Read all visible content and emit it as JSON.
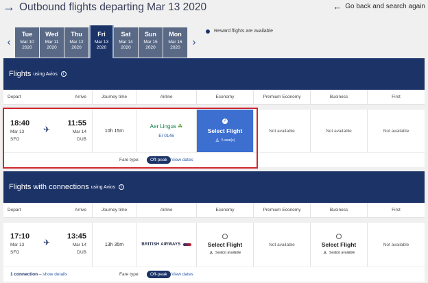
{
  "header": {
    "title": "Outbound flights departing Mar 13 2020",
    "go_back": "Go back and search again"
  },
  "dates": [
    {
      "day": "Tue",
      "date": "Mar 10\n2020",
      "selected": false
    },
    {
      "day": "Wed",
      "date": "Mar 11\n2020",
      "selected": false
    },
    {
      "day": "Thu",
      "date": "Mar 12\n2020",
      "selected": false
    },
    {
      "day": "Fri",
      "date": "Mar 13\n2020",
      "selected": true
    },
    {
      "day": "Sat",
      "date": "Mar 14\n2020",
      "selected": false
    },
    {
      "day": "Sun",
      "date": "Mar 15\n2020",
      "selected": false
    },
    {
      "day": "Mon",
      "date": "Mar 16\n2020",
      "selected": false
    }
  ],
  "reward_note": "Reward flights are available",
  "columns": {
    "depart": "Depart",
    "arrive": "Arrive",
    "journey_time": "Journey time",
    "airline": "Airline",
    "economy": "Economy",
    "premium_economy": "Premium Economy",
    "business": "Business",
    "first": "First"
  },
  "section1": {
    "title": "Flights",
    "suffix": "using Avios",
    "flight": {
      "dep_time": "18:40",
      "dep_date": "Mar 13",
      "dep_airport": "SFO",
      "arr_time": "11:55",
      "arr_date": "Mar 14",
      "arr_airport": "DUB",
      "journey": "10h 15m",
      "airline": "Aer Lingus",
      "flight_no": "EI 0146",
      "economy_label": "Select Flight",
      "economy_seats": "5 seat(s)",
      "premium": "Not available",
      "business": "Not available",
      "first": "Not available",
      "fare_type_label": "Fare type:",
      "fare_type": "Off-peak",
      "view_dates": "View dates"
    }
  },
  "section2": {
    "title": "Flights with connections",
    "suffix": "using Avios",
    "flight": {
      "dep_time": "17:10",
      "dep_date": "Mar 13",
      "dep_airport": "SFO",
      "arr_time": "13:45",
      "arr_date": "Mar 14",
      "arr_airport": "DUB",
      "journey": "13h 35m",
      "airline": "BRITISH AIRWAYS",
      "economy_label": "Select Flight",
      "economy_seats": "Seat(s) available",
      "premium": "Not available",
      "business_label": "Select Flight",
      "business_seats": "Seat(s) available",
      "first": "Not available",
      "connections": "1 connection",
      "show_details": "show details",
      "fare_type_label": "Fare type:",
      "fare_type": "Off-peak",
      "view_dates": "View dates"
    }
  }
}
